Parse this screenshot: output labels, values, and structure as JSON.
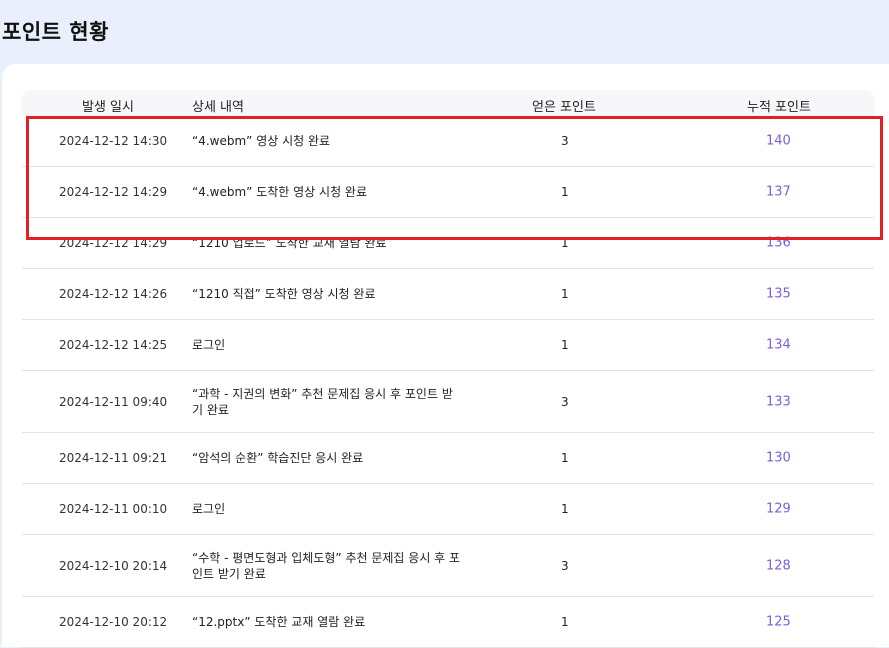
{
  "page": {
    "title": "포인트 현황"
  },
  "table": {
    "headers": {
      "date": "발생 일시",
      "description": "상세 내역",
      "earned": "얻은 포인트",
      "total": "누적 포인트"
    },
    "rows": [
      {
        "date": "2024-12-12 14:30",
        "description": "“4.webm” 영상 시청 완료",
        "earned": "3",
        "total": "140"
      },
      {
        "date": "2024-12-12 14:29",
        "description": "“4.webm” 도착한 영상 시청 완료",
        "earned": "1",
        "total": "137"
      },
      {
        "date": "2024-12-12 14:29",
        "description": "“1210 업로드” 도착한 교재 열람 완료",
        "earned": "1",
        "total": "136"
      },
      {
        "date": "2024-12-12 14:26",
        "description": "“1210 직접” 도착한 영상 시청 완료",
        "earned": "1",
        "total": "135"
      },
      {
        "date": "2024-12-12 14:25",
        "description": "로그인",
        "earned": "1",
        "total": "134"
      },
      {
        "date": "2024-12-11 09:40",
        "description": "“과학 - 지권의 변화” 추천 문제집 응시 후 포인트 받기 완료",
        "earned": "3",
        "total": "133"
      },
      {
        "date": "2024-12-11 09:21",
        "description": "“암석의 순환” 학습진단 응시 완료",
        "earned": "1",
        "total": "130"
      },
      {
        "date": "2024-12-11 00:10",
        "description": "로그인",
        "earned": "1",
        "total": "129"
      },
      {
        "date": "2024-12-10 20:14",
        "description": "“수학 - 평면도형과 입체도형” 추천 문제집 응시 후 포인트 받기 완료",
        "earned": "3",
        "total": "128"
      },
      {
        "date": "2024-12-10 20:12",
        "description": "“12.pptx” 도착한 교재 열람 완료",
        "earned": "1",
        "total": "125"
      }
    ]
  },
  "colors": {
    "accent_total": "#7b5fd6",
    "highlight_border": "#e32027",
    "page_background": "#eaf0fb"
  }
}
